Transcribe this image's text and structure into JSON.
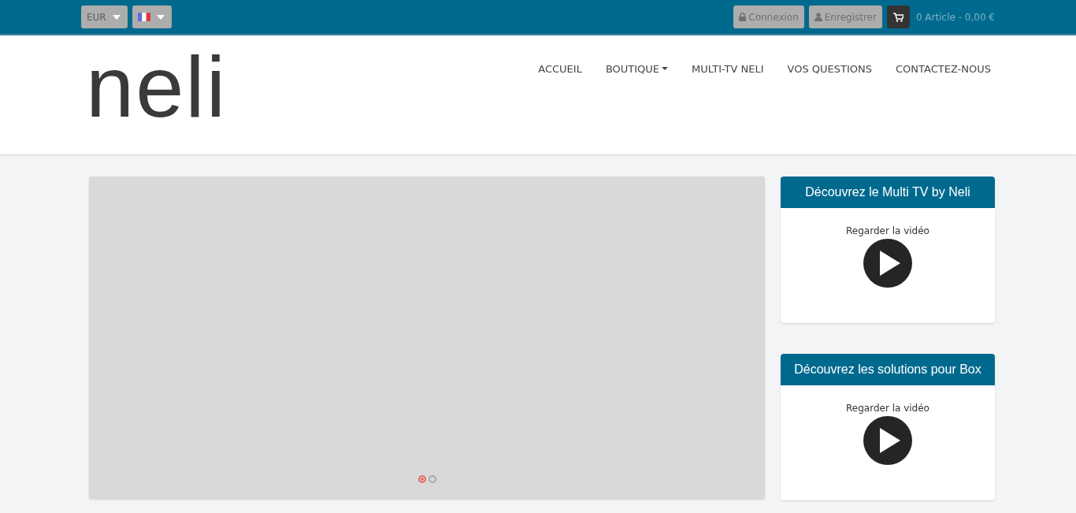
{
  "topbar": {
    "currency": "EUR",
    "language": {
      "kind": "flag"
    },
    "buttons": [
      {
        "label": "Connexion",
        "kind": "lock"
      },
      {
        "label": "Enregistrer",
        "kind": "user"
      }
    ],
    "cart": "0 Article - 0,00 €"
  },
  "header": {
    "logo": "neli",
    "nav": [
      {
        "label": "ACCUEIL",
        "dropdown": false
      },
      {
        "label": "BOUTIQUE",
        "dropdown": true
      },
      {
        "label": "MULTI-TV NELI",
        "dropdown": false
      },
      {
        "label": "VOS QUESTIONS",
        "dropdown": false
      },
      {
        "label": "CONTACTEZ-NOUS",
        "dropdown": false
      }
    ]
  },
  "slider": {
    "dots": [
      {
        "selected": true
      },
      {
        "selected": false
      }
    ]
  },
  "cards": [
    {
      "title": "Découvrez le Multi TV by Neli",
      "link": "Regarder la vidéo"
    },
    {
      "title": "Découvrez les solutions pour Box",
      "link": "Regarder la vidéo"
    }
  ]
}
